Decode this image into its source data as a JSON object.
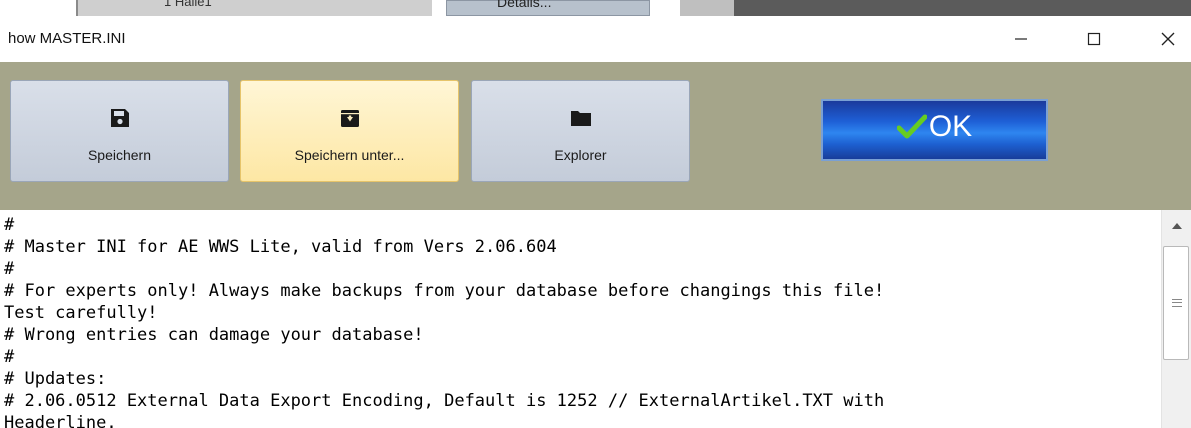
{
  "background_window": {
    "cell_text": "1 Halle1",
    "details_button": "Details..."
  },
  "window": {
    "title": "how MASTER.INI",
    "minimize_symbol": "—",
    "maximize_symbol": "☐",
    "close_symbol": "✕"
  },
  "toolbar": {
    "save_label": "Speichern",
    "save_as_label": "Speichern unter...",
    "explorer_label": "Explorer",
    "ok_label": "OK"
  },
  "colors": {
    "toolbar_bg": "#a5a58a",
    "active_button": "#fde7a4",
    "ok_button": "#1e5fd6",
    "checkmark": "#66cc22"
  },
  "editor": {
    "lines": [
      "#",
      "# Master INI for AE WWS Lite, valid from Vers 2.06.604",
      "#",
      "# For experts only! Always make backups from your database before changings this file!",
      "Test carefully!",
      "# Wrong entries can damage your database!",
      "#",
      "# Updates:",
      "# 2.06.0512 External Data Export Encoding, Default is 1252 // ExternalArtikel.TXT with",
      "Headerline."
    ]
  }
}
